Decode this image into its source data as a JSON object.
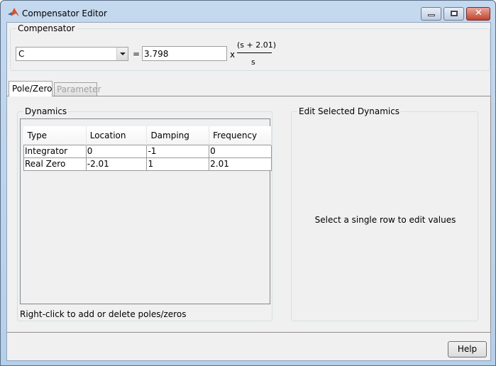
{
  "window": {
    "title": "Compensator Editor"
  },
  "compensator": {
    "group_label": "Compensator",
    "name": "C",
    "equals": "=",
    "gain": "3.798",
    "times": "x",
    "numerator": "(s + 2.01)",
    "denominator": "s"
  },
  "tabs": [
    {
      "label": "Pole/Zero",
      "active": true
    },
    {
      "label": "Parameter",
      "enabled": false
    }
  ],
  "dynamics": {
    "group_label": "Dynamics",
    "columns": [
      "Type",
      "Location",
      "Damping",
      "Frequency"
    ],
    "rows": [
      [
        "Integrator",
        "0",
        "-1",
        "0"
      ],
      [
        "Real Zero",
        "-2.01",
        "1",
        "2.01"
      ]
    ],
    "hint": "Right-click to add or delete poles/zeros"
  },
  "edit": {
    "group_label": "Edit Selected Dynamics",
    "message": "Select a single row to edit values"
  },
  "help_label": "Help"
}
